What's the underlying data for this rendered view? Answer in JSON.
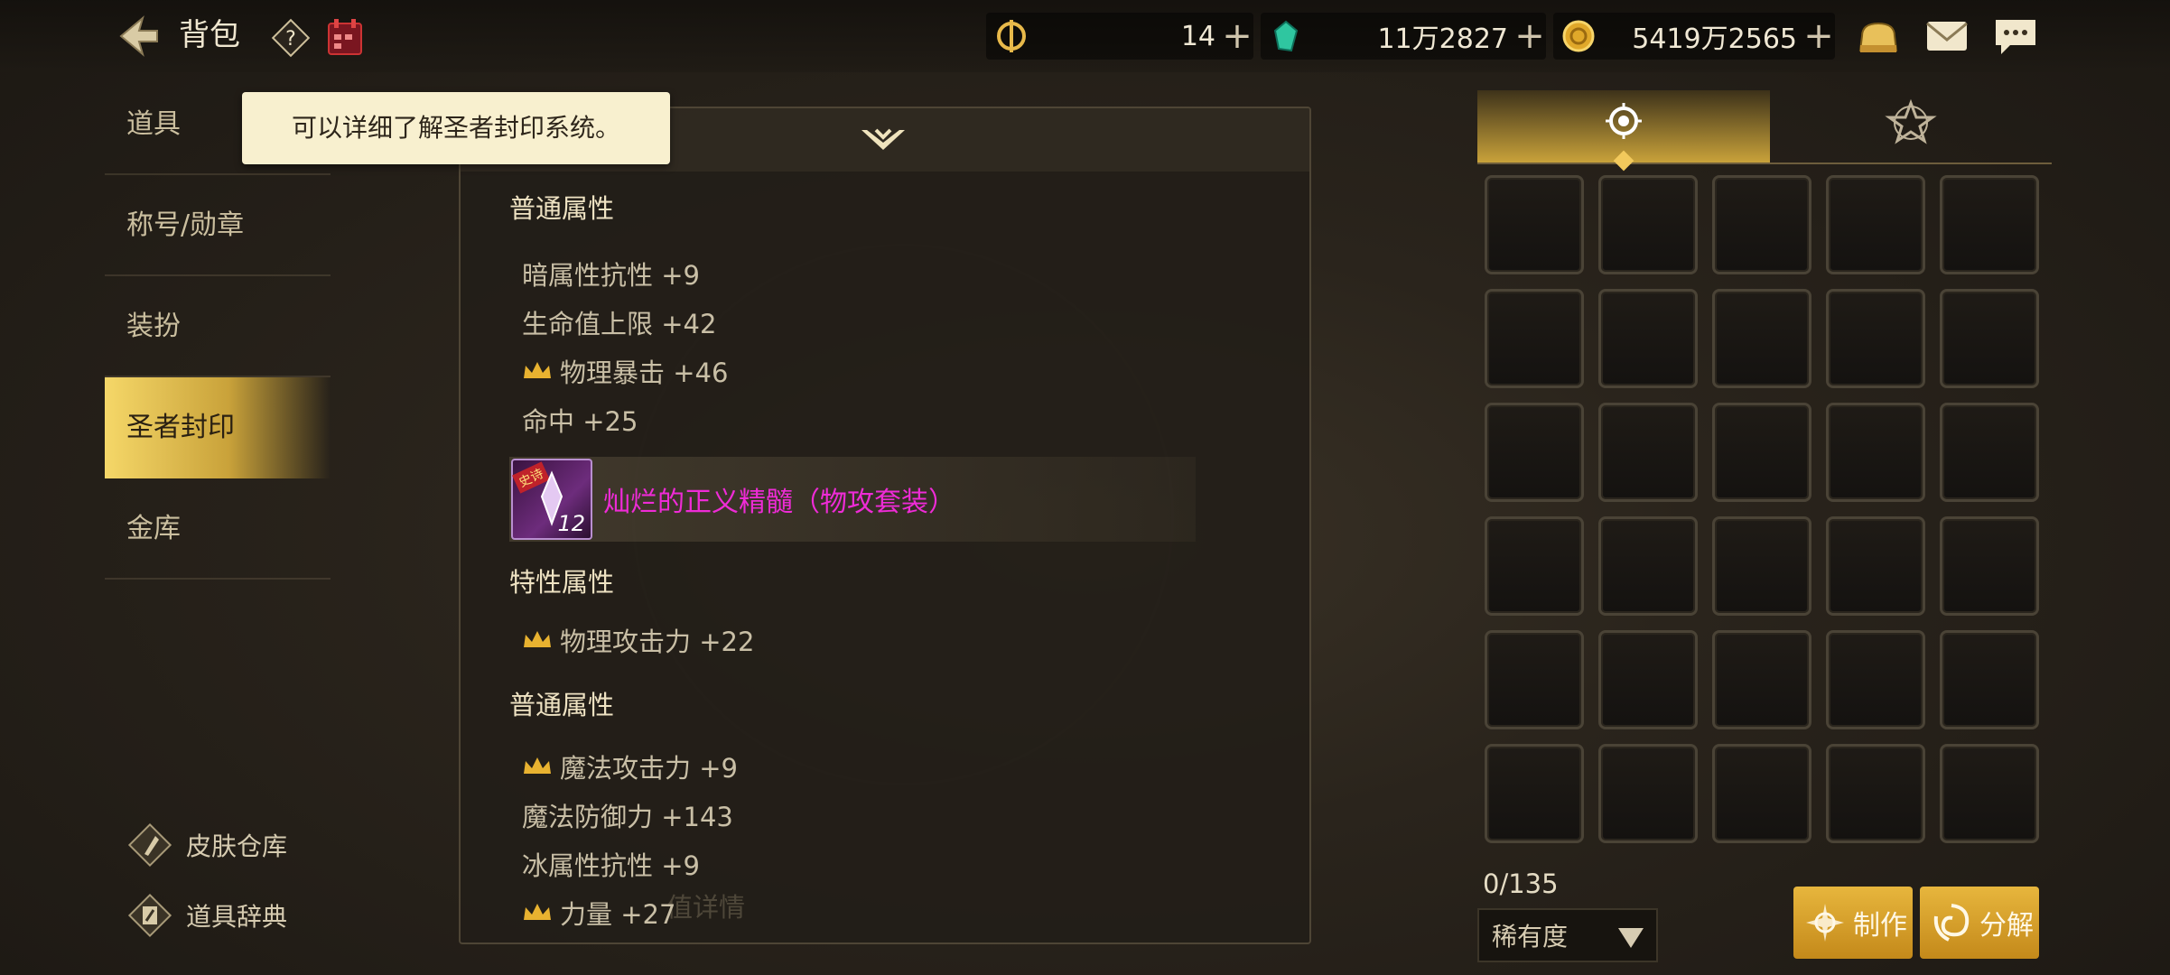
{
  "header": {
    "title": "背包",
    "currencies": [
      {
        "icon": "coin-c-icon",
        "value": "14"
      },
      {
        "icon": "crystal-icon",
        "value": "11万2827"
      },
      {
        "icon": "gold-coin-icon",
        "value": "5419万2565"
      }
    ],
    "plus_label": "+"
  },
  "nav": {
    "items": [
      {
        "label": "道具"
      },
      {
        "label": "称号/勋章"
      },
      {
        "label": "装扮"
      },
      {
        "label": "圣者封印",
        "active": true
      },
      {
        "label": "金库"
      }
    ],
    "bottom_links": [
      {
        "label": "皮肤仓库",
        "icon": "brush-icon"
      },
      {
        "label": "道具辞典",
        "icon": "book-icon"
      }
    ]
  },
  "tooltip": {
    "text": "可以详细了解圣者封印系统。"
  },
  "detail": {
    "section1_title": "普通属性",
    "section1_attrs": [
      {
        "text": "暗属性抗性 +9",
        "crown": false
      },
      {
        "text": "生命值上限 +42",
        "crown": false
      },
      {
        "text": "物理暴击 +46",
        "crown": true
      },
      {
        "text": "命中 +25",
        "crown": false
      }
    ],
    "set": {
      "name": "灿烂的正义精髓（物攻套装）",
      "level": "12",
      "tag": "史诗"
    },
    "section2_title": "特性属性",
    "section2_attrs": [
      {
        "text": "物理攻击力 +22",
        "crown": true
      }
    ],
    "section3_title": "普通属性",
    "section3_attrs": [
      {
        "text": "魔法攻击力 +9",
        "crown": true
      },
      {
        "text": "魔法防御力 +143",
        "crown": false
      },
      {
        "text": "冰属性抗性 +9",
        "crown": false
      },
      {
        "text": "力量 +27",
        "crown": true
      }
    ],
    "faded_text": "值详情"
  },
  "inventory": {
    "count": "0/135",
    "rarity_label": "稀有度",
    "craft_label": "制作",
    "decompose_label": "分解"
  },
  "colors": {
    "accent": "#c9a23a",
    "set_name": "#ee2bd6",
    "tooltip_bg": "#f8f0cf"
  }
}
